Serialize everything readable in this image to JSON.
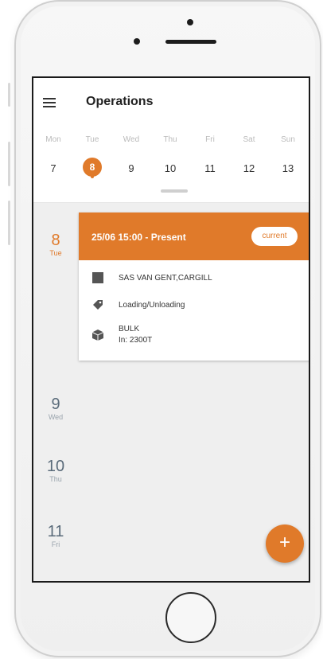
{
  "app": {
    "title": "Operations"
  },
  "week": {
    "days": [
      {
        "name": "Mon",
        "num": "7"
      },
      {
        "name": "Tue",
        "num": "8"
      },
      {
        "name": "Wed",
        "num": "9"
      },
      {
        "name": "Thu",
        "num": "10"
      },
      {
        "name": "Fri",
        "num": "11"
      },
      {
        "name": "Sat",
        "num": "12"
      },
      {
        "name": "Sun",
        "num": "13"
      }
    ],
    "selected_day": "8"
  },
  "timeline": {
    "days": [
      {
        "num": "8",
        "name": "Tue"
      },
      {
        "num": "9",
        "name": "Wed"
      },
      {
        "num": "10",
        "name": "Thu"
      },
      {
        "num": "11",
        "name": "Fri"
      }
    ]
  },
  "event": {
    "time": "25/06 15:00 - Present",
    "badge": "current",
    "client": "SAS VAN GENT,CARGILL",
    "operation": "Loading/Unloading",
    "cargo_type": "BULK",
    "cargo_amount": "In: 2300T"
  },
  "fab": {
    "label": "+"
  },
  "colors": {
    "accent": "#e07a2a",
    "text": "#333333"
  },
  "icons": [
    "menu-icon",
    "building-icon",
    "tag-icon",
    "box-icon",
    "plus-icon"
  ]
}
